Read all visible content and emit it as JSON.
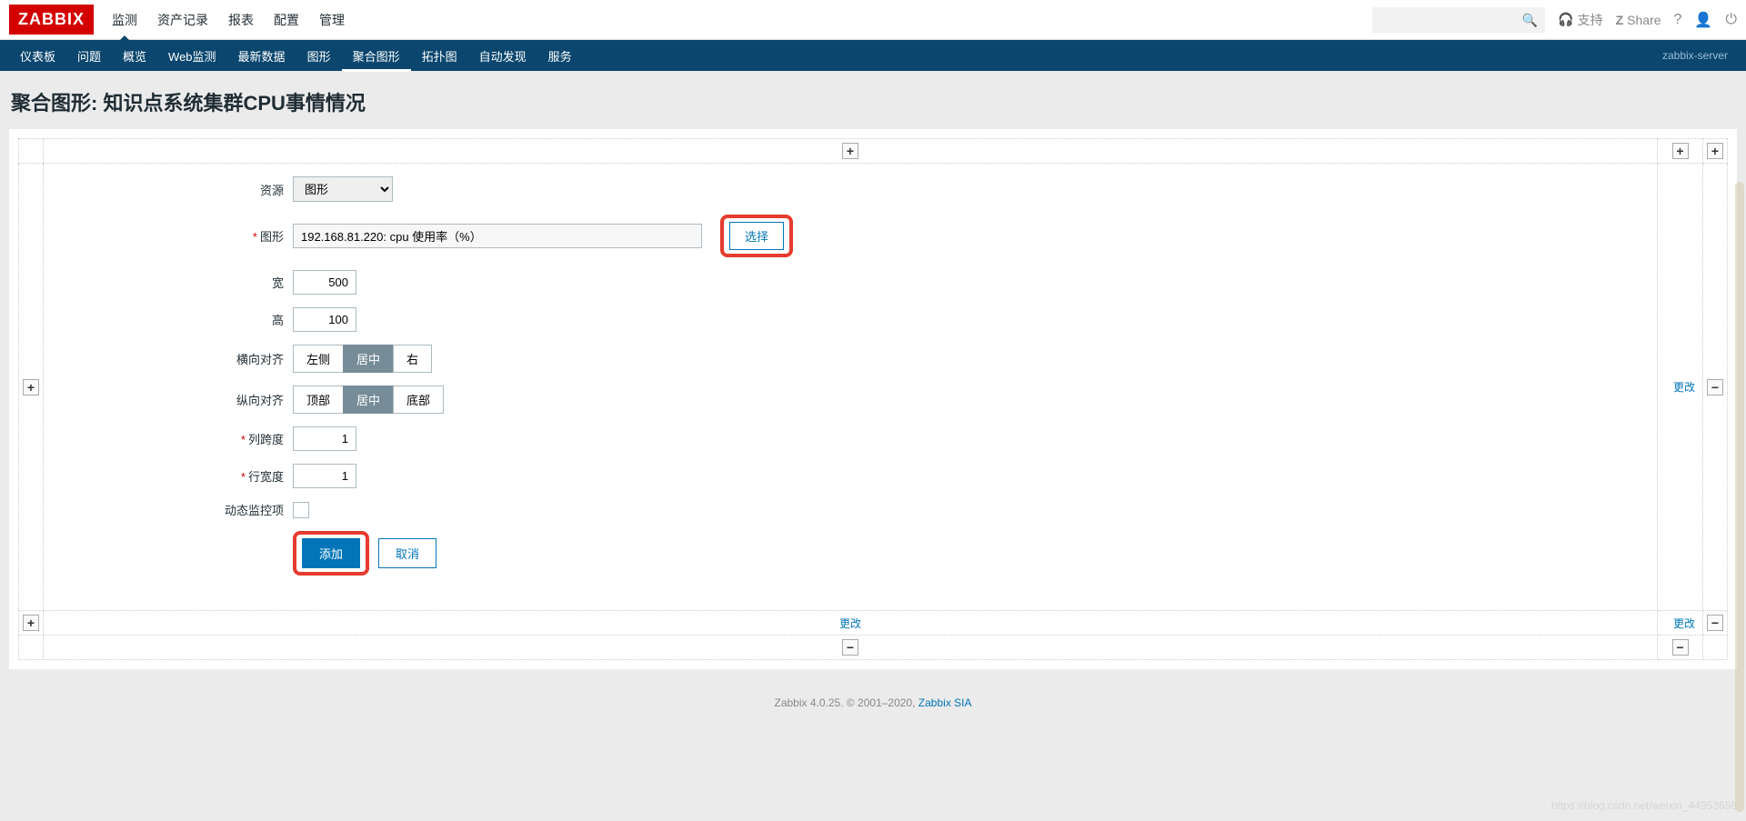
{
  "logo": "ZABBIX",
  "top_menu": [
    {
      "label": "监测",
      "active": true
    },
    {
      "label": "资产记录"
    },
    {
      "label": "报表"
    },
    {
      "label": "配置"
    },
    {
      "label": "管理"
    }
  ],
  "top_right": {
    "support": "支持",
    "share": "Share"
  },
  "sub_menu": [
    {
      "label": "仪表板"
    },
    {
      "label": "问题"
    },
    {
      "label": "概览"
    },
    {
      "label": "Web监测"
    },
    {
      "label": "最新数据"
    },
    {
      "label": "图形"
    },
    {
      "label": "聚合图形",
      "active": true
    },
    {
      "label": "拓扑图"
    },
    {
      "label": "自动发现"
    },
    {
      "label": "服务"
    }
  ],
  "server_name": "zabbix-server",
  "page_title": "聚合图形: 知识点系统集群CPU事情情况",
  "form": {
    "resource_label": "资源",
    "resource_value": "图形",
    "graph_label": "图形",
    "graph_value": "192.168.81.220: cpu 使用率（%）",
    "select_btn": "选择",
    "width_label": "宽",
    "width_value": "500",
    "height_label": "高",
    "height_value": "100",
    "halign_label": "横向对齐",
    "halign_options": [
      "左侧",
      "居中",
      "右"
    ],
    "halign_active": 1,
    "valign_label": "纵向对齐",
    "valign_options": [
      "顶部",
      "居中",
      "底部"
    ],
    "valign_active": 1,
    "colspan_label": "列跨度",
    "colspan_value": "1",
    "rowspan_label": "行宽度",
    "rowspan_value": "1",
    "dynamic_label": "动态监控项",
    "add_btn": "添加",
    "cancel_btn": "取消"
  },
  "change_link": "更改",
  "footer": {
    "text": "Zabbix 4.0.25. © 2001–2020, ",
    "link": "Zabbix SIA"
  },
  "watermark": "https://blog.csdn.net/weixin_44953658"
}
